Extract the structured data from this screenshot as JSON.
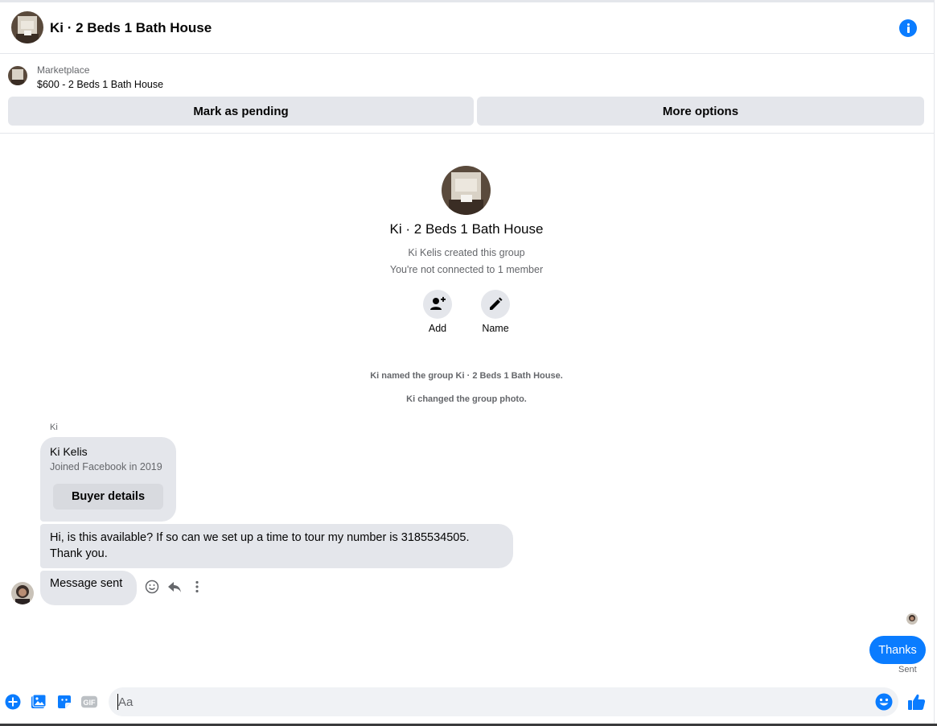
{
  "header": {
    "title": "Ki · 2 Beds 1 Bath House",
    "info_icon": "info-icon",
    "accent_color": "#0a7cff"
  },
  "marketplace": {
    "label": "Marketplace",
    "item": "$600 - 2 Beds 1 Bath House",
    "pending_button": "Mark as pending",
    "more_button": "More options"
  },
  "group": {
    "title": "Ki · 2 Beds 1 Bath House",
    "created": "Ki Kelis created this group",
    "connection": "You're not connected to 1 member",
    "actions": [
      {
        "label": "Add",
        "icon": "add-person-icon"
      },
      {
        "label": "Name",
        "icon": "pencil-icon"
      }
    ]
  },
  "system_messages": [
    "Ki named the group Ki · 2 Beds 1 Bath House.",
    "Ki changed the group photo."
  ],
  "messages": {
    "sender": "Ki",
    "buyer_card": {
      "name": "Ki Kelis",
      "joined": "Joined Facebook in 2019",
      "button": "Buyer details"
    },
    "incoming_text": "Hi, is this available? If so can we set up a time to tour my number is 3185534505. Thank you.",
    "auto_reply": "Message sent",
    "outgoing_text": "Thanks",
    "outgoing_status": "Sent",
    "hover_actions": [
      "react-icon",
      "reply-icon",
      "more-vertical-icon"
    ]
  },
  "composer": {
    "placeholder": "Aa",
    "icons": [
      "plus-circle-icon",
      "image-icon",
      "sticker-icon",
      "gif-icon",
      "emoji-icon",
      "thumbs-up-icon"
    ]
  }
}
